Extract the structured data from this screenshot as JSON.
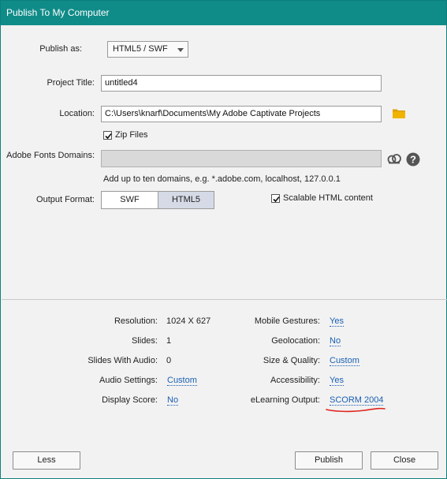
{
  "window": {
    "title": "Publish To My Computer"
  },
  "publish_as": {
    "label": "Publish as:",
    "value": "HTML5 / SWF"
  },
  "project_title": {
    "label": "Project Title:",
    "value": "untitled4"
  },
  "location": {
    "label": "Location:",
    "value": "C:\\Users\\knarf\\Documents\\My Adobe Captivate Projects",
    "icon": "folder-icon"
  },
  "zip_files": {
    "label": "Zip Files",
    "checked": true
  },
  "fonts_domains": {
    "label": "Adobe Fonts Domains:",
    "value": "",
    "hint": "Add up to ten domains, e.g. *.adobe.com, localhost, 127.0.0.1",
    "icons": [
      "creative-cloud-icon",
      "help-icon"
    ]
  },
  "output_format": {
    "label": "Output Format:",
    "options": [
      "SWF",
      "HTML5"
    ],
    "selected": "HTML5",
    "scalable_label": "Scalable HTML content",
    "scalable_checked": true
  },
  "info": {
    "resolution_label": "Resolution:",
    "resolution_value": "1024 X 627",
    "slides_label": "Slides:",
    "slides_value": "1",
    "slides_audio_label": "Slides With Audio:",
    "slides_audio_value": "0",
    "audio_settings_label": "Audio Settings:",
    "audio_settings_value": "Custom",
    "display_score_label": "Display Score:",
    "display_score_value": "No",
    "mobile_gestures_label": "Mobile Gestures:",
    "mobile_gestures_value": "Yes",
    "geolocation_label": "Geolocation:",
    "geolocation_value": "No",
    "size_quality_label": "Size & Quality:",
    "size_quality_value": "Custom",
    "accessibility_label": "Accessibility:",
    "accessibility_value": "Yes",
    "elearning_label": "eLearning Output:",
    "elearning_value": "SCORM 2004"
  },
  "buttons": {
    "less": "Less",
    "publish": "Publish",
    "close": "Close"
  },
  "colors": {
    "titlebar": "#0f8b88",
    "link": "#1a5fb4",
    "annotation": "#e0231e",
    "folder": "#e0a100"
  }
}
